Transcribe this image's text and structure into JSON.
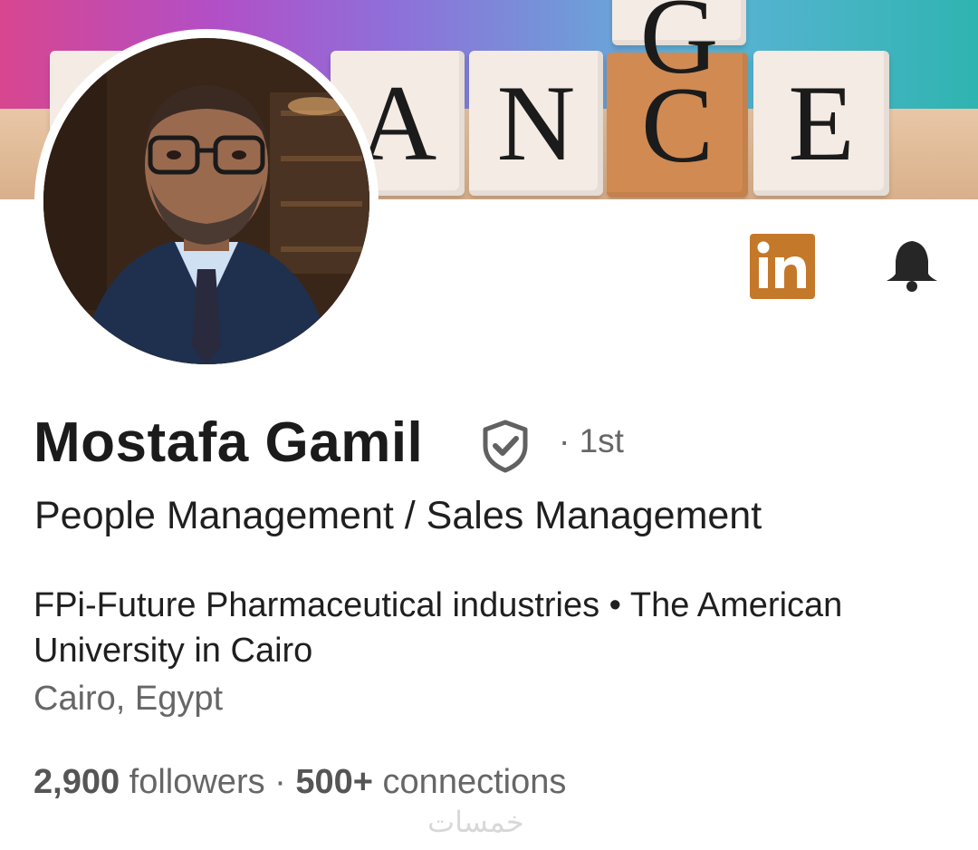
{
  "banner": {
    "tiles": [
      "A",
      "N",
      "C",
      "E"
    ],
    "top_tile": "G"
  },
  "profile": {
    "name": "Mostafa Gamil",
    "degree": "· 1st",
    "headline": "People Management / Sales Management",
    "organizations": "FPi-Future Pharmaceutical industries • The American University in Cairo",
    "location": "Cairo, Egypt",
    "followers_count": "2,900",
    "followers_label": "followers",
    "separator": " · ",
    "connections_count": "500+",
    "connections_label": "connections"
  },
  "icons": {
    "linkedin": "linkedin-icon",
    "bell": "bell-icon",
    "verified": "verified-shield-icon"
  },
  "colors": {
    "linkedin_badge": "#c4782a",
    "text_primary": "#1b1b1b",
    "text_secondary": "#666666"
  },
  "watermark": "خمسات"
}
